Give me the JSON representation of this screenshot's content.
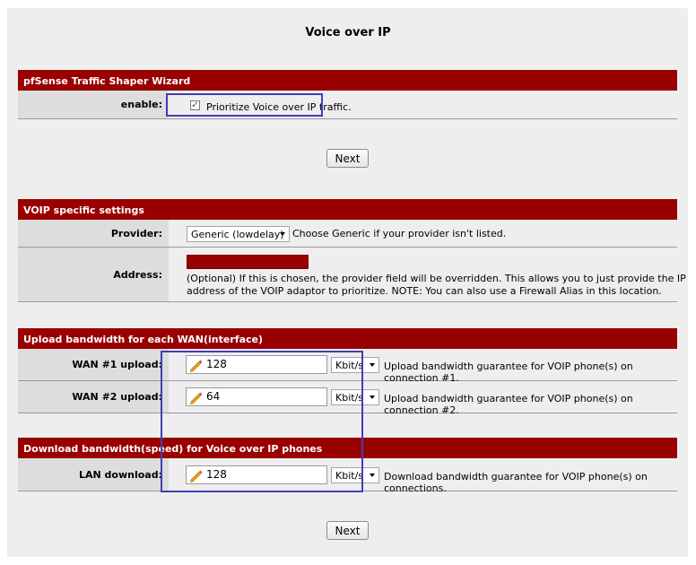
{
  "page_title": "Voice over IP",
  "sections": {
    "wizard": {
      "header": "pfSense Traffic Shaper Wizard",
      "enable_label": "enable:",
      "enable_checkbox_text": "Prioritize Voice over IP traffic.",
      "enable_checked": true
    },
    "voip": {
      "header": "VOIP specific settings",
      "provider_label": "Provider:",
      "provider_value": "Generic (lowdelay)",
      "provider_note": "Choose Generic if your provider isn't listed.",
      "address_label": "Address:",
      "address_value": "",
      "address_note": "(Optional) If this is chosen, the provider field will be overridden. This allows you to just provide the IP address of the VOIP adaptor to prioritize. NOTE: You can also use a Firewall Alias in this location."
    },
    "upload": {
      "header": "Upload bandwidth for each WAN(interface)",
      "wan1_label": "WAN #1 upload:",
      "wan1_value": "128",
      "wan1_unit": "Kbit/s",
      "wan1_note": "Upload bandwidth guarantee for VOIP phone(s) on connection #1.",
      "wan2_label": "WAN #2 upload:",
      "wan2_value": "64",
      "wan2_unit": "Kbit/s",
      "wan2_note": "Upload bandwidth guarantee for VOIP phone(s) on connection #2."
    },
    "download": {
      "header": "Download bandwidth(speed) for Voice over IP phones",
      "lan_label": "LAN download:",
      "lan_value": "128",
      "lan_unit": "Kbit/s",
      "lan_note": "Download bandwidth guarantee for VOIP phone(s) on connections."
    }
  },
  "buttons": {
    "next_top": "Next",
    "next_bottom": "Next"
  },
  "colors": {
    "header_bg": "#990000",
    "label_bg": "#dddddd",
    "highlight": "#3f3fb5"
  },
  "icons": {
    "input_icon": "pencil-icon",
    "select_arrow": "chevron-down-icon"
  }
}
